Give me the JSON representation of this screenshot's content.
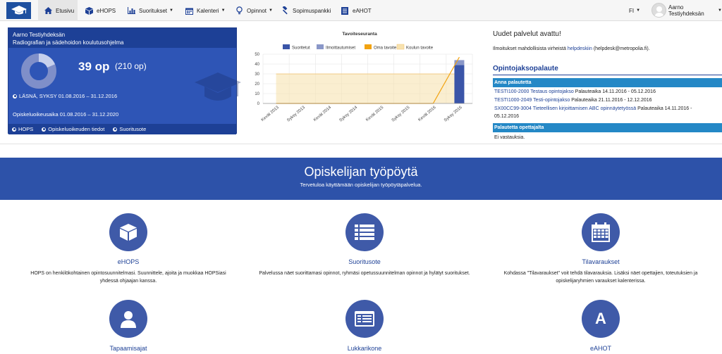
{
  "nav": {
    "items": [
      {
        "label": "Etusivu",
        "icon": "home-icon",
        "dropdown": false
      },
      {
        "label": "eHOPS",
        "icon": "cube-icon",
        "dropdown": false
      },
      {
        "label": "Suoritukset",
        "icon": "bar-chart-icon",
        "dropdown": true
      },
      {
        "label": "Kalenteri",
        "icon": "calendar-icon",
        "dropdown": true
      },
      {
        "label": "Opinnot",
        "icon": "lightbulb-icon",
        "dropdown": true
      },
      {
        "label": "Sopimuspankki",
        "icon": "gavel-icon",
        "dropdown": false
      },
      {
        "label": "eAHOT",
        "icon": "document-icon",
        "dropdown": false
      }
    ],
    "language": "FI",
    "user": "Aarno Testiyhdeksän"
  },
  "student": {
    "name": "Aarno Testiyhdeksän",
    "program": "Radiografian ja sädehoidon koulutusohjelma",
    "credits": "39 op",
    "credits_total": "(210 op)",
    "completed_fraction": 0.186,
    "status": "LÄSNÄ, SYKSY 01.08.2016 – 31.12.2016",
    "study_period": "Opiskeluoikeusaika 01.08.2016 – 31.12.2020",
    "links": [
      "HOPS",
      "Opiskeluoikeuden tiedot",
      "Suoritusote"
    ]
  },
  "chart_data": {
    "type": "line",
    "title": "Tavoiteseuranta",
    "categories": [
      "Kevät 2013",
      "Syksy 2013",
      "Kevät 2014",
      "Syksy 2014",
      "Kevät 2015",
      "Syksy 2015",
      "Kevät 2016",
      "Syksy 2016"
    ],
    "ylim": [
      0,
      50
    ],
    "yticks": [
      0,
      10,
      20,
      30,
      40,
      50
    ],
    "series": [
      {
        "name": "Suoritetut",
        "kind": "bar",
        "color": "#3a55a8",
        "values": [
          0,
          0,
          0,
          0,
          0,
          0,
          0,
          39
        ]
      },
      {
        "name": "Ilmoittautumiset",
        "kind": "bar",
        "color": "#8a97c8",
        "values": [
          0,
          0,
          0,
          0,
          0,
          0,
          0,
          5
        ]
      },
      {
        "name": "Oma tavoite",
        "kind": "line",
        "color": "#f2a310",
        "values": [
          0,
          0,
          0,
          0,
          0,
          0,
          0,
          47
        ]
      },
      {
        "name": "Koulun tavoite",
        "kind": "area",
        "color": "#f7e2b0",
        "values": [
          30,
          30,
          30,
          30,
          30,
          30,
          30,
          30
        ]
      }
    ],
    "grid": true,
    "legend": "top"
  },
  "news": {
    "title": "Uudet palvelut avattu!",
    "text_before": "Ilmoitukset mahdollisista virheistä",
    "link": "helpdeskiin",
    "text_after": "(helpdesk@metropolia.fi)."
  },
  "feedback": {
    "title": "Opintojaksopalaute",
    "give_header": "Anna palautetta",
    "rows": [
      {
        "code": "TESTI100-2000 Testaus opintojakso",
        "period": "Palauteaika 14.11.2016 - 05.12.2016"
      },
      {
        "code": "TESTI1000-2049 Testi-opintojakso",
        "period": "Palauteaika 21.11.2016 - 12.12.2016"
      },
      {
        "code": "SX00CC99-3004 Tieteellisen kirjoittamisen ABC opinnäytetyössä",
        "period": "Palauteaika 14.11.2016 -"
      },
      {
        "code": "",
        "period": "05.12.2016"
      }
    ],
    "teacher_header": "Palautetta opettajalta",
    "no_answers": "Ei vastauksia."
  },
  "hero": {
    "title": "Opiskelijan työpöytä",
    "subtitle": "Tervetuloa käyttämään opiskelijan työpöytäpalvelua."
  },
  "tiles": [
    {
      "title": "eHOPS",
      "icon": "cube-icon",
      "desc": "HOPS on henkilökohtainen opintosuunnitelmasi. Suunnittele, ajoita ja muokkaa HOPSiasi yhdessä ohjaajan kanssa."
    },
    {
      "title": "Suoritusote",
      "icon": "list-icon",
      "desc": "Palvelussa näet suorittamasi opinnot, ryhmäsi opetussuunnitelman opinnot ja hylätyt suoritukset."
    },
    {
      "title": "Tilavaraukset",
      "icon": "calendar-icon",
      "desc": "Kohdassa \"Tilavaraukset\" voit tehdä tilavarauksia. Lisäksi näet opettajien, toteutuksien ja opiskelijaryhmien varaukset kalenterissa."
    },
    {
      "title": "Tapaamisajat",
      "icon": "user-icon",
      "desc": ""
    },
    {
      "title": "Lukkarikone",
      "icon": "schedule-icon",
      "desc": ""
    },
    {
      "title": "eAHOT",
      "icon": "letter-a-icon",
      "letter": "A",
      "desc": ""
    }
  ]
}
